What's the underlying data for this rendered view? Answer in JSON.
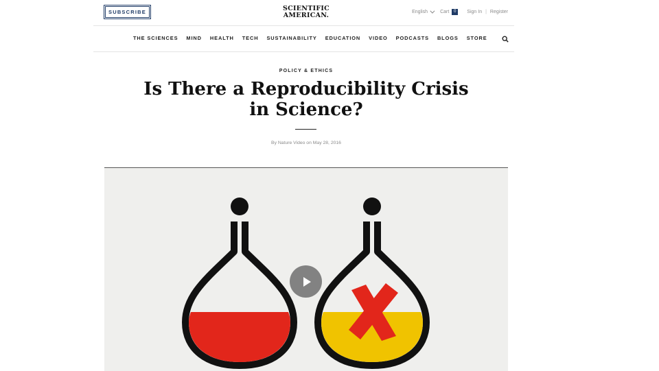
{
  "header": {
    "subscribe_label": "SUBSCRIBE",
    "logo_line1": "SCIENTIFIC",
    "logo_line2": "AMERICAN.",
    "language": "English",
    "cart_label": "Cart",
    "cart_count": "0",
    "sign_in": "Sign In",
    "separator": "|",
    "register": "Register"
  },
  "nav": {
    "items": [
      "THE SCIENCES",
      "MIND",
      "HEALTH",
      "TECH",
      "SUSTAINABILITY",
      "EDUCATION",
      "VIDEO",
      "PODCASTS",
      "BLOGS",
      "STORE"
    ],
    "search_icon": "search-icon"
  },
  "article": {
    "kicker": "POLICY & ETHICS",
    "title_line1": "Is There a Reproducibility Crisis",
    "title_line2": "in Science?",
    "byline": "By Nature Video on May 28, 2016"
  },
  "video": {
    "play_icon": "play-icon",
    "colors": {
      "red_liquid": "#e2261b",
      "yellow_liquid": "#f0c300",
      "cross": "#e2261b",
      "outline": "#111111"
    }
  }
}
